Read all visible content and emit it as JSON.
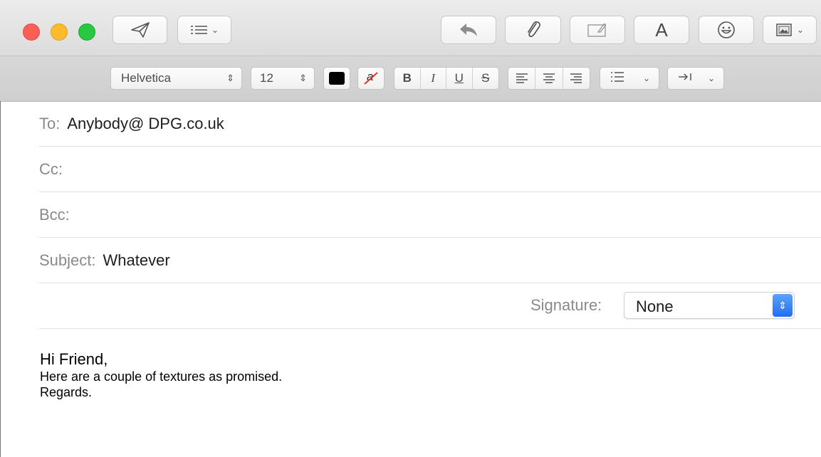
{
  "toolbar": {
    "format_label": "A",
    "emoji_label": "☺"
  },
  "format_bar": {
    "font_family": "Helvetica",
    "font_size": "12",
    "text_color": "#000000",
    "background_color_glyph": "a",
    "bold_label": "B",
    "italic_label": "I",
    "underline_label": "U",
    "strike_label": "S"
  },
  "headers": {
    "to_label": "To:",
    "to_value": "Anybody@ DPG.co.uk",
    "cc_label": "Cc:",
    "cc_value": "",
    "bcc_label": "Bcc:",
    "bcc_value": "",
    "subject_label": "Subject:",
    "subject_value": "Whatever"
  },
  "signature": {
    "label": "Signature:",
    "value": "None"
  },
  "message": {
    "greeting": "Hi Friend,",
    "lines": [
      "Here are a couple of textures as promised.",
      "Regards."
    ]
  },
  "colors": {
    "close": "#fd5f57",
    "minimize": "#fdbb2d",
    "zoom": "#28c841",
    "accent": "#1f6ff0"
  }
}
